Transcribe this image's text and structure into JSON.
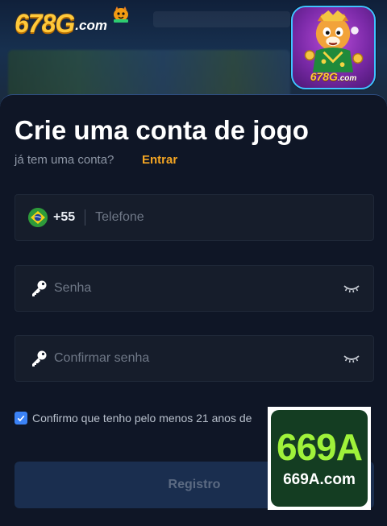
{
  "header": {
    "logo_main": "678G",
    "logo_suffix": ".com"
  },
  "app_icon": {
    "label_main": "678G",
    "label_suffix": ".com",
    "icon": "tiger-mascot-icon"
  },
  "form": {
    "title": "Crie uma conta de jogo",
    "subtitle": "já tem uma conta?",
    "login_link": "Entrar",
    "phone": {
      "country_code": "+55",
      "flag_icon": "brazil-flag-icon",
      "placeholder": "Telefone"
    },
    "password": {
      "placeholder": "Senha",
      "icon": "key-icon",
      "toggle_icon": "eye-closed-icon"
    },
    "confirm_password": {
      "placeholder": "Confirmar senha",
      "icon": "key-icon",
      "toggle_icon": "eye-closed-icon"
    },
    "age_checkbox": {
      "checked": true,
      "label": "Confirmo que tenho pelo menos 21 anos de"
    },
    "register_button": "Registro"
  },
  "watermark": {
    "main": "669A",
    "site": "669A.com"
  },
  "colors": {
    "background": "#0f1626",
    "field": "#161d2b",
    "accent_link": "#f5a623",
    "checkbox": "#3b82f6",
    "button": "#1a2e4f",
    "watermark_green": "#9ff23a"
  }
}
